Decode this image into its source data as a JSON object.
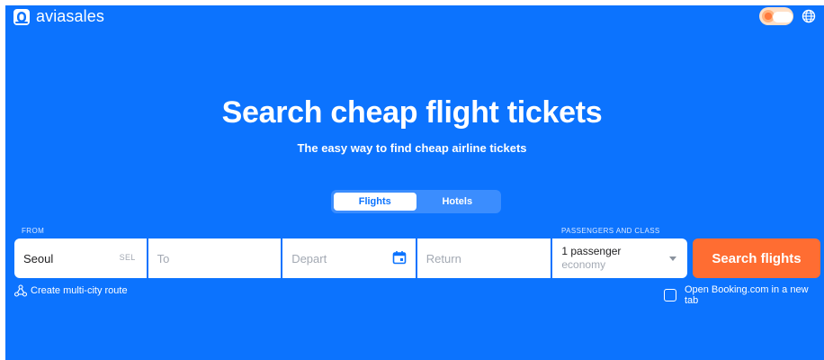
{
  "header": {
    "logo_text": "aviasales",
    "logo_icon": "aviasales-logo-icon",
    "theme_toggle_icon": "sun-cloud-toggle-icon",
    "language_icon": "globe-icon"
  },
  "hero": {
    "title": "Search cheap flight tickets",
    "subtitle": "The easy way to find cheap airline tickets"
  },
  "tabs": [
    {
      "label": "Flights",
      "active": true
    },
    {
      "label": "Hotels",
      "active": false
    }
  ],
  "form": {
    "from_label": "FROM",
    "from_value": "Seoul",
    "from_code": "SEL",
    "to_placeholder": "To",
    "depart_placeholder": "Depart",
    "return_placeholder": "Return",
    "passengers_label": "PASSENGERS AND CLASS",
    "passengers_value": "1 passenger",
    "class_value": "economy",
    "search_label": "Search flights"
  },
  "options": {
    "multi_city_label": "Create multi-city route",
    "booking_label": "Open Booking.com in a new tab",
    "booking_checked": false
  },
  "colors": {
    "background": "#0c73fe",
    "search_button": "#ff6d32",
    "tab_track": "#3b8dfe"
  }
}
